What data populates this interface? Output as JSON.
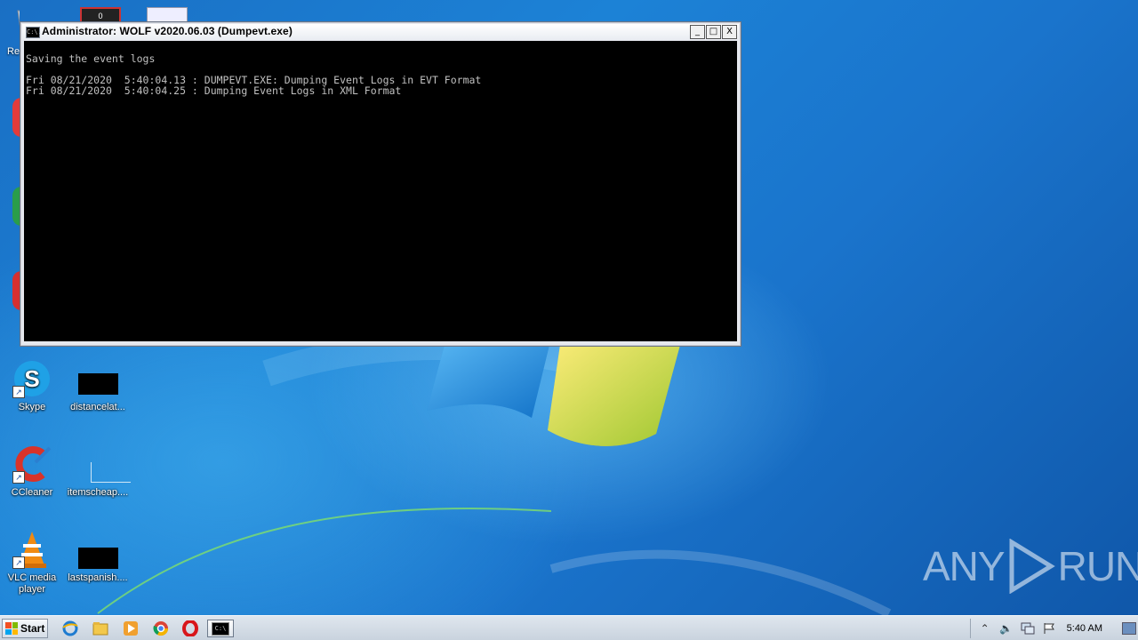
{
  "console_window": {
    "title": "Administrator:  WOLF v2020.06.03 (Dumpevt.exe)",
    "icon_text": "C:\\.",
    "buttons": {
      "minimize": "_",
      "maximize": "□",
      "close": "X"
    },
    "lines": [
      "Saving the event logs",
      "",
      "Fri 08/21/2020  5:40:04.13 : DUMPEVT.EXE: Dumping Event Logs in EVT Format",
      "Fri 08/21/2020  5:40:04.25 : Dumping Event Logs in XML Format"
    ]
  },
  "desktop": {
    "partial_left_label": "Re",
    "top_icon_text": "0",
    "icons": [
      {
        "label": "Skype"
      },
      {
        "label": "distancelat..."
      },
      {
        "label": "CCleaner"
      },
      {
        "label": "itemscheap...."
      },
      {
        "label": "VLC media player"
      },
      {
        "label": "lastspanish...."
      }
    ]
  },
  "taskbar": {
    "start_label": "Start",
    "clock": "5:40 AM"
  },
  "watermark": {
    "left": "ANY",
    "right": "RUN"
  }
}
